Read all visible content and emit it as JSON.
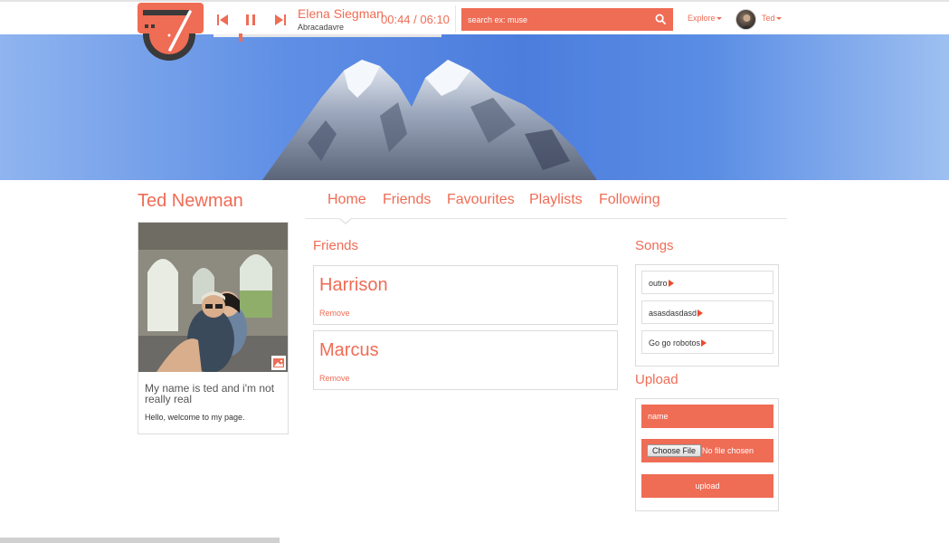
{
  "player": {
    "track_title": "Elena Siegman",
    "track_artist": "Abracadavre",
    "current_time": "00:44",
    "total_time": "06:10",
    "time_display": "00:44 / 06:10",
    "progress_fraction": 0.12
  },
  "search": {
    "placeholder": "search ex: muse"
  },
  "nav": {
    "explore_label": "Explore",
    "user_label": "Ted"
  },
  "profile": {
    "name": "Ted Newman",
    "bio": "My name is ted and i'm not really real",
    "welcome": "Hello, welcome to my page."
  },
  "tabs": [
    {
      "label": "Home",
      "active": true
    },
    {
      "label": "Friends"
    },
    {
      "label": "Favourites"
    },
    {
      "label": "Playlists"
    },
    {
      "label": "Following"
    }
  ],
  "friends": {
    "title": "Friends",
    "items": [
      {
        "name": "Harrison",
        "action": "Remove"
      },
      {
        "name": "Marcus",
        "action": "Remove"
      }
    ]
  },
  "songs": {
    "title": "Songs",
    "items": [
      {
        "label": "outro"
      },
      {
        "label": "asasdasdasd"
      },
      {
        "label": "Go go robotos"
      }
    ]
  },
  "upload": {
    "title": "Upload",
    "name_placeholder": "name",
    "choose_file_label": "Choose File",
    "no_file_text": "No file chosen",
    "submit_label": "upload"
  },
  "colors": {
    "accent": "#ef6c55",
    "logo_dark": "#3a3a3a",
    "banner_sky": "#5f8fe5"
  }
}
